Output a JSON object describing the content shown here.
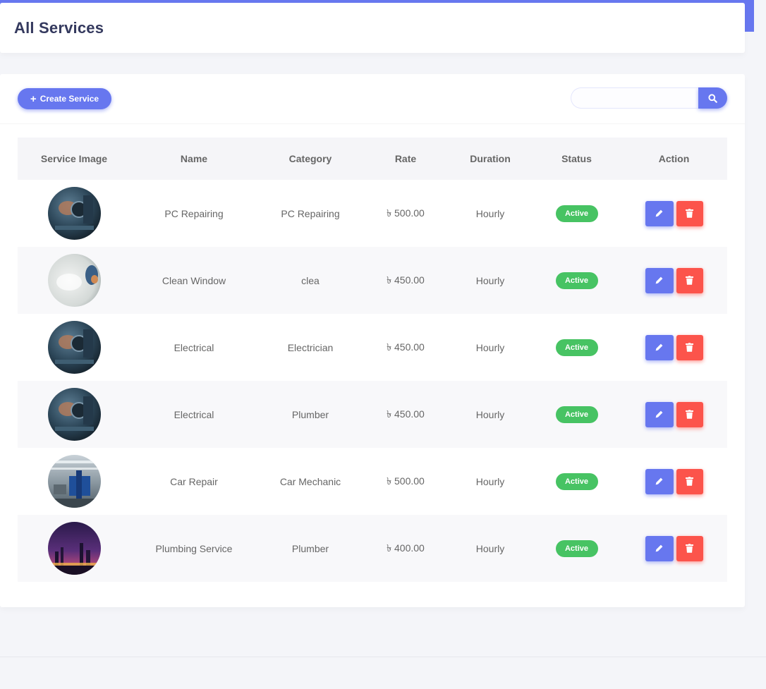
{
  "page": {
    "title": "All Services"
  },
  "toolbar": {
    "create_label": "Create Service",
    "search_placeholder": "",
    "search_value": ""
  },
  "table": {
    "columns": [
      "Service Image",
      "Name",
      "Category",
      "Rate",
      "Duration",
      "Status",
      "Action"
    ],
    "rows": [
      {
        "image": "pc-repair-photo",
        "name": "PC Repairing",
        "category": "PC Repairing",
        "rate": "৳ 500.00",
        "duration": "Hourly",
        "status": "Active"
      },
      {
        "image": "window-cleaning-photo",
        "name": "Clean Window",
        "category": "clea",
        "rate": "৳ 450.00",
        "duration": "Hourly",
        "status": "Active"
      },
      {
        "image": "pc-repair-photo",
        "name": "Electrical",
        "category": "Electrician",
        "rate": "৳ 450.00",
        "duration": "Hourly",
        "status": "Active"
      },
      {
        "image": "pc-repair-photo",
        "name": "Electrical",
        "category": "Plumber",
        "rate": "৳ 450.00",
        "duration": "Hourly",
        "status": "Active"
      },
      {
        "image": "car-workshop-photo",
        "name": "Car Repair",
        "category": "Car Mechanic",
        "rate": "৳ 500.00",
        "duration": "Hourly",
        "status": "Active"
      },
      {
        "image": "city-night-photo",
        "name": "Plumbing Service",
        "category": "Plumber",
        "rate": "৳ 400.00",
        "duration": "Hourly",
        "status": "Active"
      }
    ]
  },
  "colors": {
    "primary": "#6777ef",
    "danger": "#fc544b",
    "success": "#47c363",
    "heading": "#34395e"
  },
  "icons": {
    "create": "plus-icon",
    "search": "search-icon",
    "edit": "pencil-icon",
    "delete": "trash-icon"
  }
}
